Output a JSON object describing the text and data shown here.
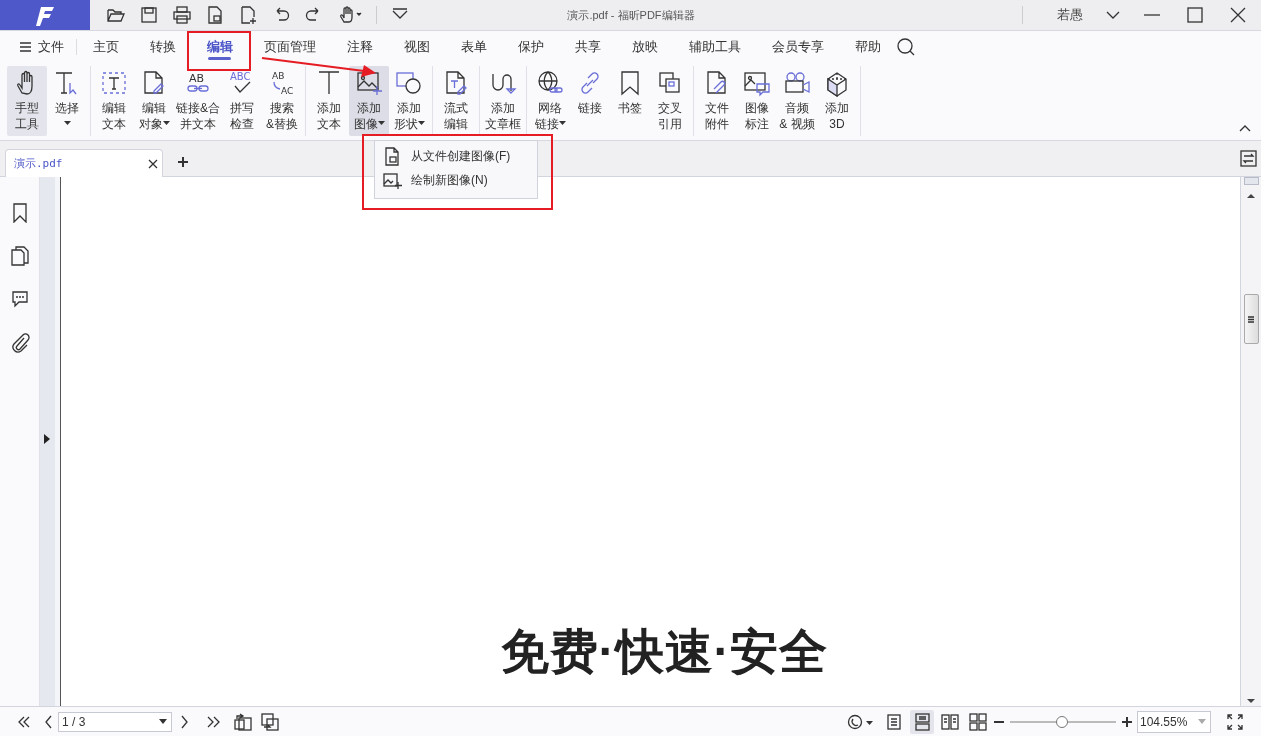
{
  "title_bar": {
    "title": "演示.pdf - 福昕PDF编辑器",
    "user": "若愚"
  },
  "menu_bar": {
    "file_label": "文件",
    "tabs": [
      {
        "label": "主页",
        "selected": false
      },
      {
        "label": "转换",
        "selected": false
      },
      {
        "label": "编辑",
        "selected": true
      },
      {
        "label": "页面管理",
        "selected": false
      },
      {
        "label": "注释",
        "selected": false
      },
      {
        "label": "视图",
        "selected": false
      },
      {
        "label": "表单",
        "selected": false
      },
      {
        "label": "保护",
        "selected": false
      },
      {
        "label": "共享",
        "selected": false
      },
      {
        "label": "放映",
        "selected": false
      },
      {
        "label": "辅助工具",
        "selected": false
      },
      {
        "label": "会员专享",
        "selected": false
      },
      {
        "label": "帮助",
        "selected": false
      }
    ]
  },
  "ribbon": {
    "groups": [
      [
        {
          "lines": [
            "手型",
            "工具"
          ],
          "selected": true
        },
        {
          "lines": [
            "选择"
          ],
          "dropdown": true,
          "selected": false
        }
      ],
      [
        {
          "lines": [
            "编辑",
            "文本"
          ],
          "selected": false
        },
        {
          "lines": [
            "编辑",
            "对象"
          ],
          "dropdown": true,
          "selected": false
        },
        {
          "lines": [
            "链接&合",
            "并文本"
          ],
          "selected": false,
          "icon_text": [
            "AB"
          ]
        },
        {
          "lines": [
            "拼写",
            "检查"
          ],
          "selected": false,
          "icon_text": [
            "ABC"
          ]
        },
        {
          "lines": [
            "搜索",
            "&替换"
          ],
          "selected": false,
          "icon_text": [
            "AB",
            "AC"
          ]
        }
      ],
      [
        {
          "lines": [
            "添加",
            "文本"
          ],
          "selected": false
        },
        {
          "lines": [
            "添加",
            "图像"
          ],
          "dropdown": true,
          "selected": false,
          "expanded": true
        },
        {
          "lines": [
            "添加",
            "形状"
          ],
          "dropdown": true,
          "selected": false
        }
      ],
      [
        {
          "lines": [
            "流式",
            "编辑"
          ],
          "selected": false
        }
      ],
      [
        {
          "lines": [
            "添加",
            "文章框"
          ],
          "selected": false
        }
      ],
      [
        {
          "lines": [
            "网络",
            "链接"
          ],
          "dropdown": true,
          "selected": false
        },
        {
          "lines": [
            "链接"
          ],
          "selected": false
        },
        {
          "lines": [
            "书签"
          ],
          "selected": false
        },
        {
          "lines": [
            "交叉",
            "引用"
          ],
          "selected": false
        }
      ],
      [
        {
          "lines": [
            "文件",
            "附件"
          ],
          "selected": false
        },
        {
          "lines": [
            "图像",
            "标注"
          ],
          "selected": false
        },
        {
          "lines": [
            "音频",
            "& 视频"
          ],
          "selected": false
        },
        {
          "lines": [
            "添加",
            "3D"
          ],
          "selected": false
        }
      ]
    ]
  },
  "image_menu": {
    "items": [
      "从文件创建图像(F)",
      "绘制新图像(N)"
    ]
  },
  "doc_tabs": [
    {
      "label": "演示.pdf",
      "selected": true
    }
  ],
  "page": {
    "text": "免费·快速·安全"
  },
  "status_bar": {
    "page": "1 / 3",
    "view_modes": [
      {
        "selected": false
      },
      {
        "selected": true
      },
      {
        "selected": false
      },
      {
        "selected": false
      }
    ],
    "zoom_slider": {
      "level": 0.49
    },
    "zoom": "104.55%"
  }
}
